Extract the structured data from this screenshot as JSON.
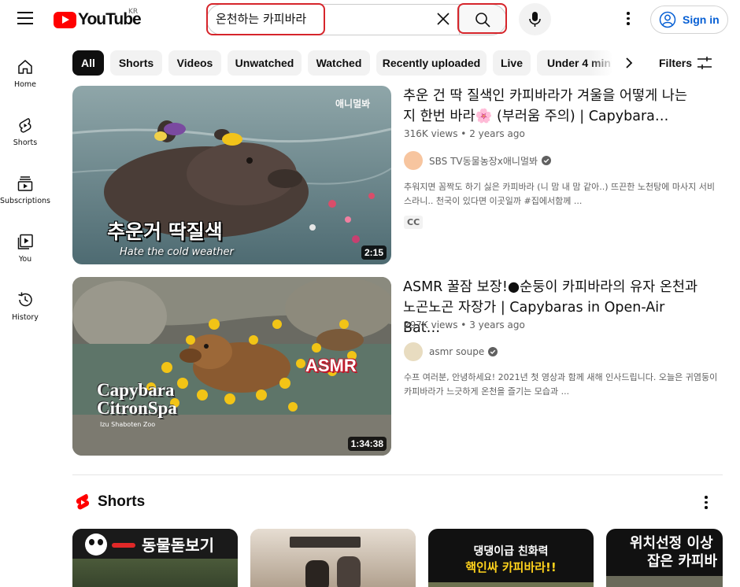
{
  "header": {
    "logo_text": "YouTube",
    "region": "KR",
    "search_value": "온천하는 카피바라",
    "signin_label": "Sign in"
  },
  "sidebar": {
    "items": [
      {
        "label": "Home",
        "icon": "home-icon"
      },
      {
        "label": "Shorts",
        "icon": "shorts-icon"
      },
      {
        "label": "Subscriptions",
        "icon": "subscriptions-icon"
      },
      {
        "label": "You",
        "icon": "you-icon"
      },
      {
        "label": "History",
        "icon": "history-icon"
      }
    ]
  },
  "chips": [
    "All",
    "Shorts",
    "Videos",
    "Unwatched",
    "Watched",
    "Recently uploaded",
    "Live",
    "Under 4 min"
  ],
  "filters_label": "Filters",
  "videos": [
    {
      "title_line1": "추운 건 딱 질색인 카피바라가 겨울을 어떻게 나는",
      "title_line2": "지 한번 바라🌸 (부러움 주의) | Capybara…",
      "views": "316K views",
      "age": "2 years ago",
      "channel": "SBS TV동물농장x애니멀봐",
      "desc_line1": "추워지면 꼼짝도 하기 싫은 카피바라 (니 맘 내 맘 같아..) 뜨끈한 노천탕에 마사지 서비",
      "desc_line2": "스라니.. 천국이 있다면 이곳일까 #집에서함께 ...",
      "badge": "CC",
      "duration": "2:15",
      "thumb_caption_ko": "추운거 딱질색",
      "thumb_caption_en": "Hate the cold weather",
      "thumb_corner": "애니멀봐"
    },
    {
      "title_line1": "ASMR 꿀잠 보장!●순둥이 카피바라의 유자 온천과",
      "title_line2": "노곤노곤 자장가 | Capybaras in Open-Air Bat…",
      "views": "297K views",
      "age": "3 years ago",
      "channel": "asmr soupe",
      "desc_line1": "수프 여러분, 안녕하세요! 2021년 첫 영상과 함께 새해 인사드립니다. 오늘은 귀염둥이",
      "desc_line2": "카피바라가 느긋하게 온천을 즐기는 모습과 ...",
      "duration": "1:34:38",
      "thumb_asmr": "ASMR",
      "thumb_title1": "Capybara",
      "thumb_title2": "CitronSpa",
      "thumb_sub": "Izu Shaboten Zoo"
    }
  ],
  "shorts": {
    "title": "Shorts",
    "items": [
      {
        "text": "동물돋보기"
      },
      {
        "text": ""
      },
      {
        "text_line1": "댕댕이급 친화력",
        "text_line2": "핵인싸 카피바라!!"
      },
      {
        "text_line1": "위치선정 이상",
        "text_line2": "잡은 카피바"
      }
    ]
  },
  "colors": {
    "brand_red": "#ff0000",
    "highlight_red": "#d6252b",
    "link_blue": "#065fd4"
  }
}
